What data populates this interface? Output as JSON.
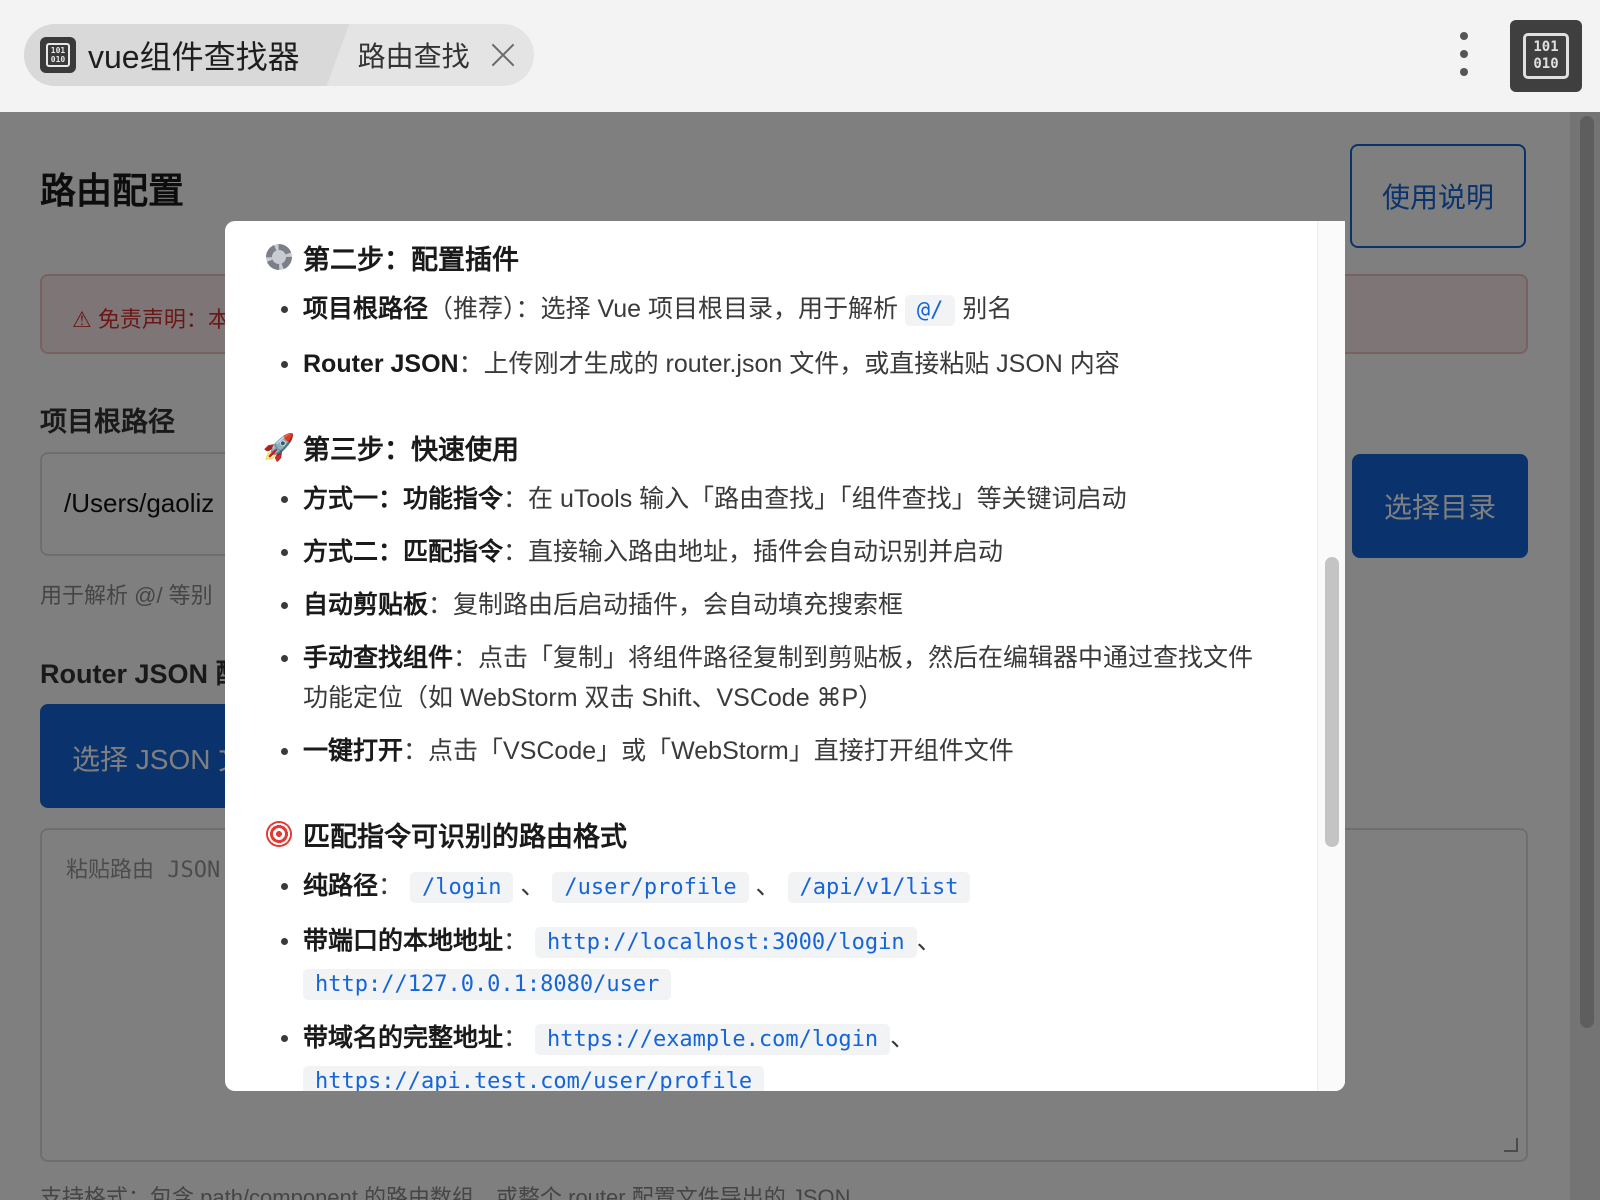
{
  "topbar": {
    "app_tab_title": "vue组件查找器",
    "second_tab_label": "路由查找",
    "app_icon_glyph": "101\n010",
    "right_icon_glyph": "101\n010"
  },
  "page": {
    "title": "路由配置",
    "help_button": "使用说明",
    "disclaimer": "⚠ 免责声明：本",
    "root_label": "项目根路径",
    "root_input_value": "/Users/gaoliz",
    "choose_dir_button": "选择目录",
    "root_hint": "用于解析 @/ 等别",
    "router_label": "Router JSON 配",
    "choose_json_button": "选择 JSON 文",
    "json_placeholder": "粘贴路由 JSON",
    "support_hint": "支持格式：包含 path/component 的路由数组，或整个 router 配置文件导出的 JSON"
  },
  "modal": {
    "step2": {
      "heading": "第二步：配置插件",
      "items": [
        {
          "key": "项目根路径",
          "mid": "（推荐）：选择 Vue 项目根目录，用于解析",
          "code": "@/",
          "tail": "别名"
        },
        {
          "key": "Router JSON",
          "text": "：上传刚才生成的 router.json 文件，或直接粘贴 JSON 内容"
        }
      ]
    },
    "step3": {
      "heading": "第三步：快速使用",
      "items": [
        {
          "key": "方式一：功能指令",
          "text": "：在 uTools 输入「路由查找」「组件查找」等关键词启动"
        },
        {
          "key": "方式二：匹配指令",
          "text": "：直接输入路由地址，插件会自动识别并启动"
        },
        {
          "key": "自动剪贴板",
          "text": "：复制路由后启动插件，会自动填充搜索框"
        },
        {
          "key": "手动查找组件",
          "text": "：点击「复制」将组件路径复制到剪贴板，然后在编辑器中通过查找文件功能定位（如 WebStorm 双击 Shift、VSCode ⌘P）"
        },
        {
          "key": "一键打开",
          "text": "：点击「VSCode」或「WebStorm」直接打开组件文件"
        }
      ]
    },
    "formats": {
      "heading": "匹配指令可识别的路由格式",
      "pure_key": "纯路径",
      "pure_codes": [
        "/login",
        "/user/profile",
        "/api/v1/list"
      ],
      "local_key": "带端口的本地地址",
      "local_codes": [
        "http://localhost:3000/login",
        "http://127.0.0.1:8080/user"
      ],
      "domain_key": "带域名的完整地址",
      "domain_codes": [
        "https://example.com/login",
        "https://api.test.com/user/profile"
      ],
      "colon": "：",
      "sep": "、"
    }
  }
}
